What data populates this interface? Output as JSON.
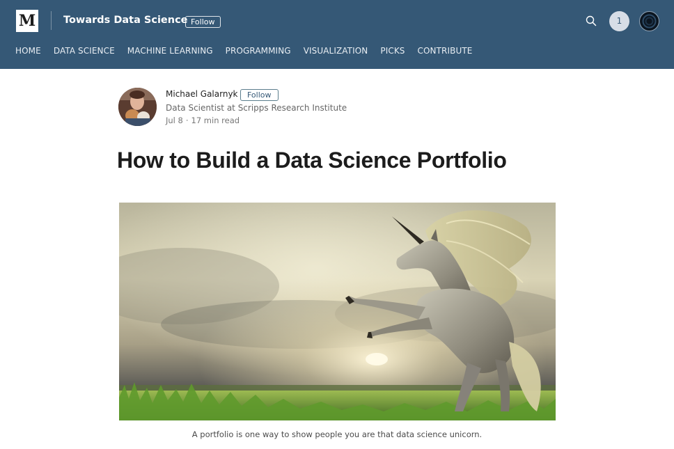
{
  "header": {
    "logo_letter": "M",
    "publication_title": "Towards Data Science",
    "follow_label": "Follow",
    "notification_count": "1",
    "icons": {
      "search": "search-icon",
      "profile": "user-avatar"
    },
    "background_color": "#355876"
  },
  "nav": {
    "items": [
      {
        "label": "HOME"
      },
      {
        "label": "DATA SCIENCE"
      },
      {
        "label": "MACHINE LEARNING"
      },
      {
        "label": "PROGRAMMING"
      },
      {
        "label": "VISUALIZATION"
      },
      {
        "label": "PICKS"
      },
      {
        "label": "CONTRIBUTE"
      }
    ]
  },
  "author": {
    "name": "Michael Galarnyk",
    "follow_label": "Follow",
    "bio": "Data Scientist at Scripps Research Institute",
    "date": "Jul 8",
    "separator": "·",
    "read_time": "17 min read"
  },
  "article": {
    "title": "How to Build a Data Science Portfolio",
    "hero_image": "unicorn-rearing-in-grass-field-at-sunset",
    "caption": "A portfolio is one way to show people you are that data science unicorn."
  }
}
